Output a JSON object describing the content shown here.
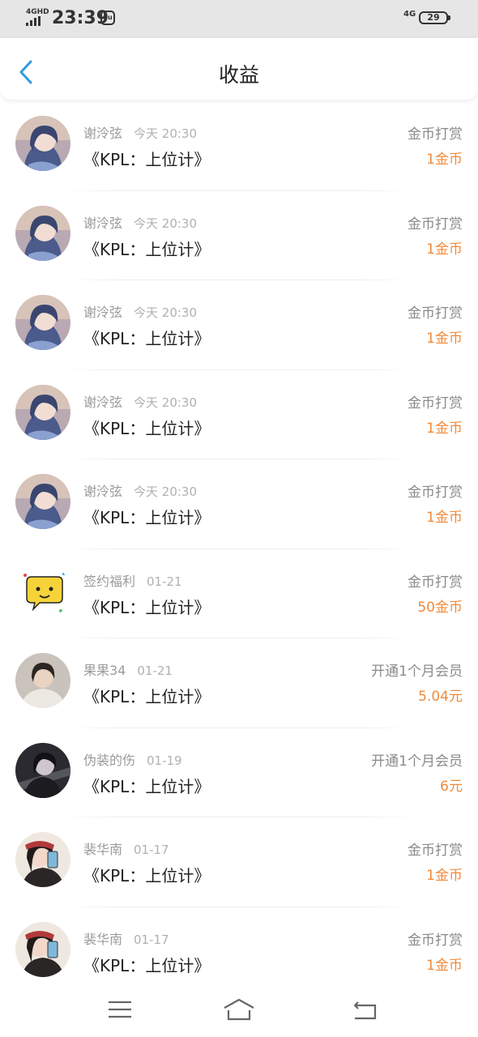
{
  "status_bar": {
    "network": "4GHD",
    "time": "23:39",
    "app_badge": "du",
    "cell": "4G",
    "battery": "29"
  },
  "header": {
    "title": "收益"
  },
  "records": [
    {
      "name": "谢泠弦",
      "time": "今天 20:30",
      "work": "《KPL：上位计》",
      "type": "金币打赏",
      "amount": "1金币",
      "avatar": "girl-blue"
    },
    {
      "name": "谢泠弦",
      "time": "今天 20:30",
      "work": "《KPL：上位计》",
      "type": "金币打赏",
      "amount": "1金币",
      "avatar": "girl-blue"
    },
    {
      "name": "谢泠弦",
      "time": "今天 20:30",
      "work": "《KPL：上位计》",
      "type": "金币打赏",
      "amount": "1金币",
      "avatar": "girl-blue"
    },
    {
      "name": "谢泠弦",
      "time": "今天 20:30",
      "work": "《KPL：上位计》",
      "type": "金币打赏",
      "amount": "1金币",
      "avatar": "girl-blue"
    },
    {
      "name": "谢泠弦",
      "time": "今天 20:30",
      "work": "《KPL：上位计》",
      "type": "金币打赏",
      "amount": "1金币",
      "avatar": "girl-blue"
    },
    {
      "name": "签约福利",
      "time": "01-21",
      "work": "《KPL：上位计》",
      "type": "金币打赏",
      "amount": "50金币",
      "avatar": "emoji-bubble"
    },
    {
      "name": "果果34",
      "time": "01-21",
      "work": "《KPL：上位计》",
      "type": "开通1个月会员",
      "amount": "5.04元",
      "avatar": "person-light"
    },
    {
      "name": "伪装的伤",
      "time": "01-19",
      "work": "《KPL：上位计》",
      "type": "开通1个月会员",
      "amount": "6元",
      "avatar": "person-dark"
    },
    {
      "name": "裴华南",
      "time": "01-17",
      "work": "《KPL：上位计》",
      "type": "金币打赏",
      "amount": "1金币",
      "avatar": "girl-selfie"
    },
    {
      "name": "裴华南",
      "time": "01-17",
      "work": "《KPL：上位计》",
      "type": "金币打赏",
      "amount": "1金币",
      "avatar": "girl-selfie"
    }
  ],
  "colors": {
    "accent_blue": "#2f9be0",
    "amount_orange": "#f08a3a",
    "status_bar_bg": "#e6e6e6"
  },
  "nav": {
    "menu": "menu-icon",
    "home": "home-icon",
    "back": "back-icon"
  }
}
